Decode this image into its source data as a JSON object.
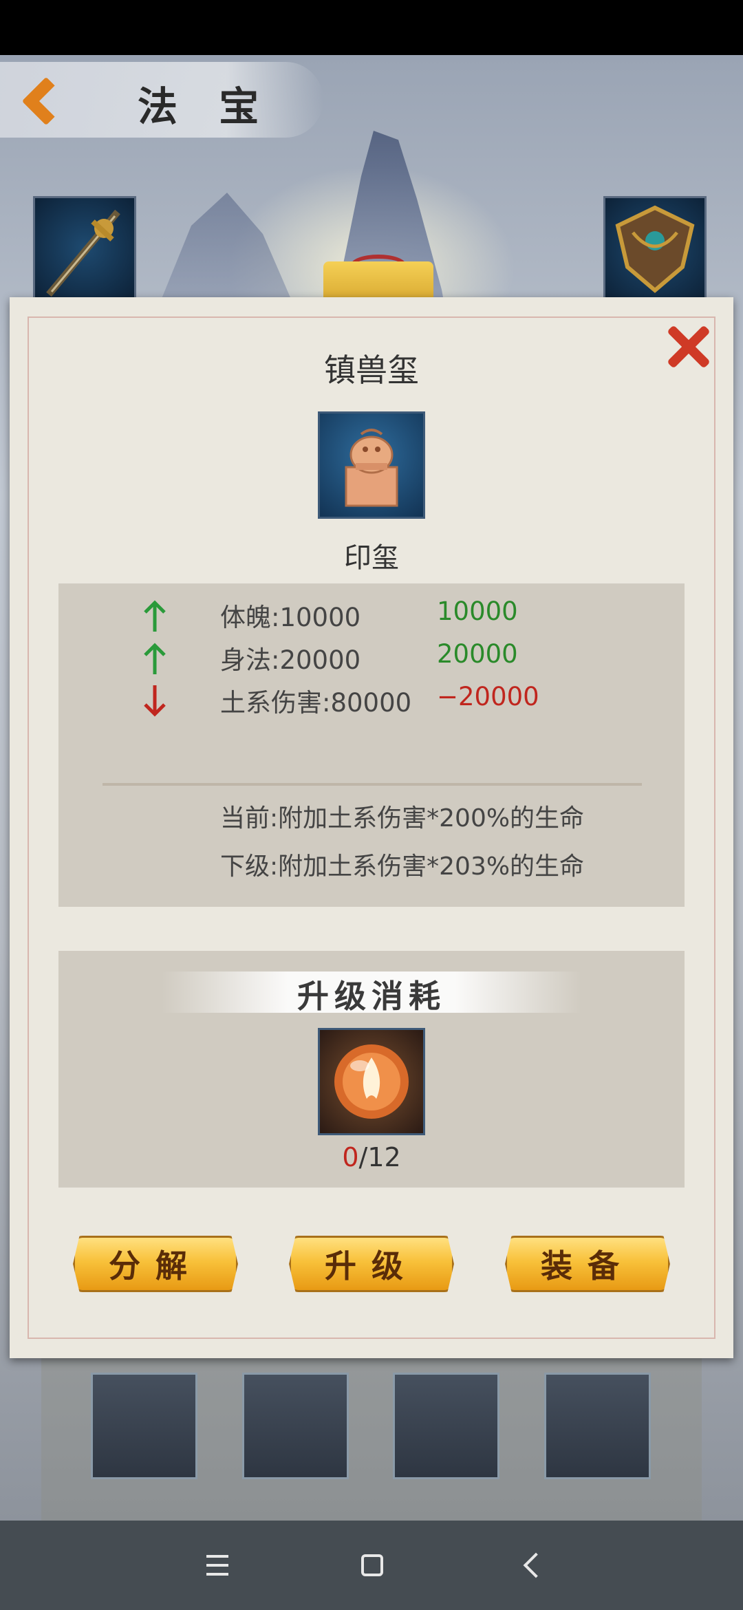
{
  "header": {
    "title": "法 宝"
  },
  "dialog": {
    "item_name": "镇兽玺",
    "item_type": "印玺",
    "stats": [
      {
        "direction": "up",
        "label": "体魄:10000",
        "diff": "10000",
        "color": "#2a8a2a"
      },
      {
        "direction": "up",
        "label": "身法:20000",
        "diff": "20000",
        "color": "#2a8a2a"
      },
      {
        "direction": "down",
        "label": "土系伤害:80000",
        "diff": "−20000",
        "color": "#c0261e"
      }
    ],
    "effect_current": "当前:附加土系伤害*200%的生命",
    "effect_next": "下级:附加土系伤害*203%的生命",
    "cost_title": "升级消耗",
    "cost_have": "0",
    "cost_need": "/12",
    "buttons": {
      "decompose": "分解",
      "upgrade": "升级",
      "equip": "装备"
    }
  },
  "icons": {
    "back": "back-chevron-icon",
    "close": "close-x-icon",
    "sword": "sword-icon",
    "shield": "shield-icon",
    "seal": "seal-icon",
    "orb": "fire-orb-icon"
  },
  "colors": {
    "accent": "#f8c13a",
    "close": "#cf3a26",
    "up": "#2a8a2a",
    "down": "#c0261e"
  }
}
